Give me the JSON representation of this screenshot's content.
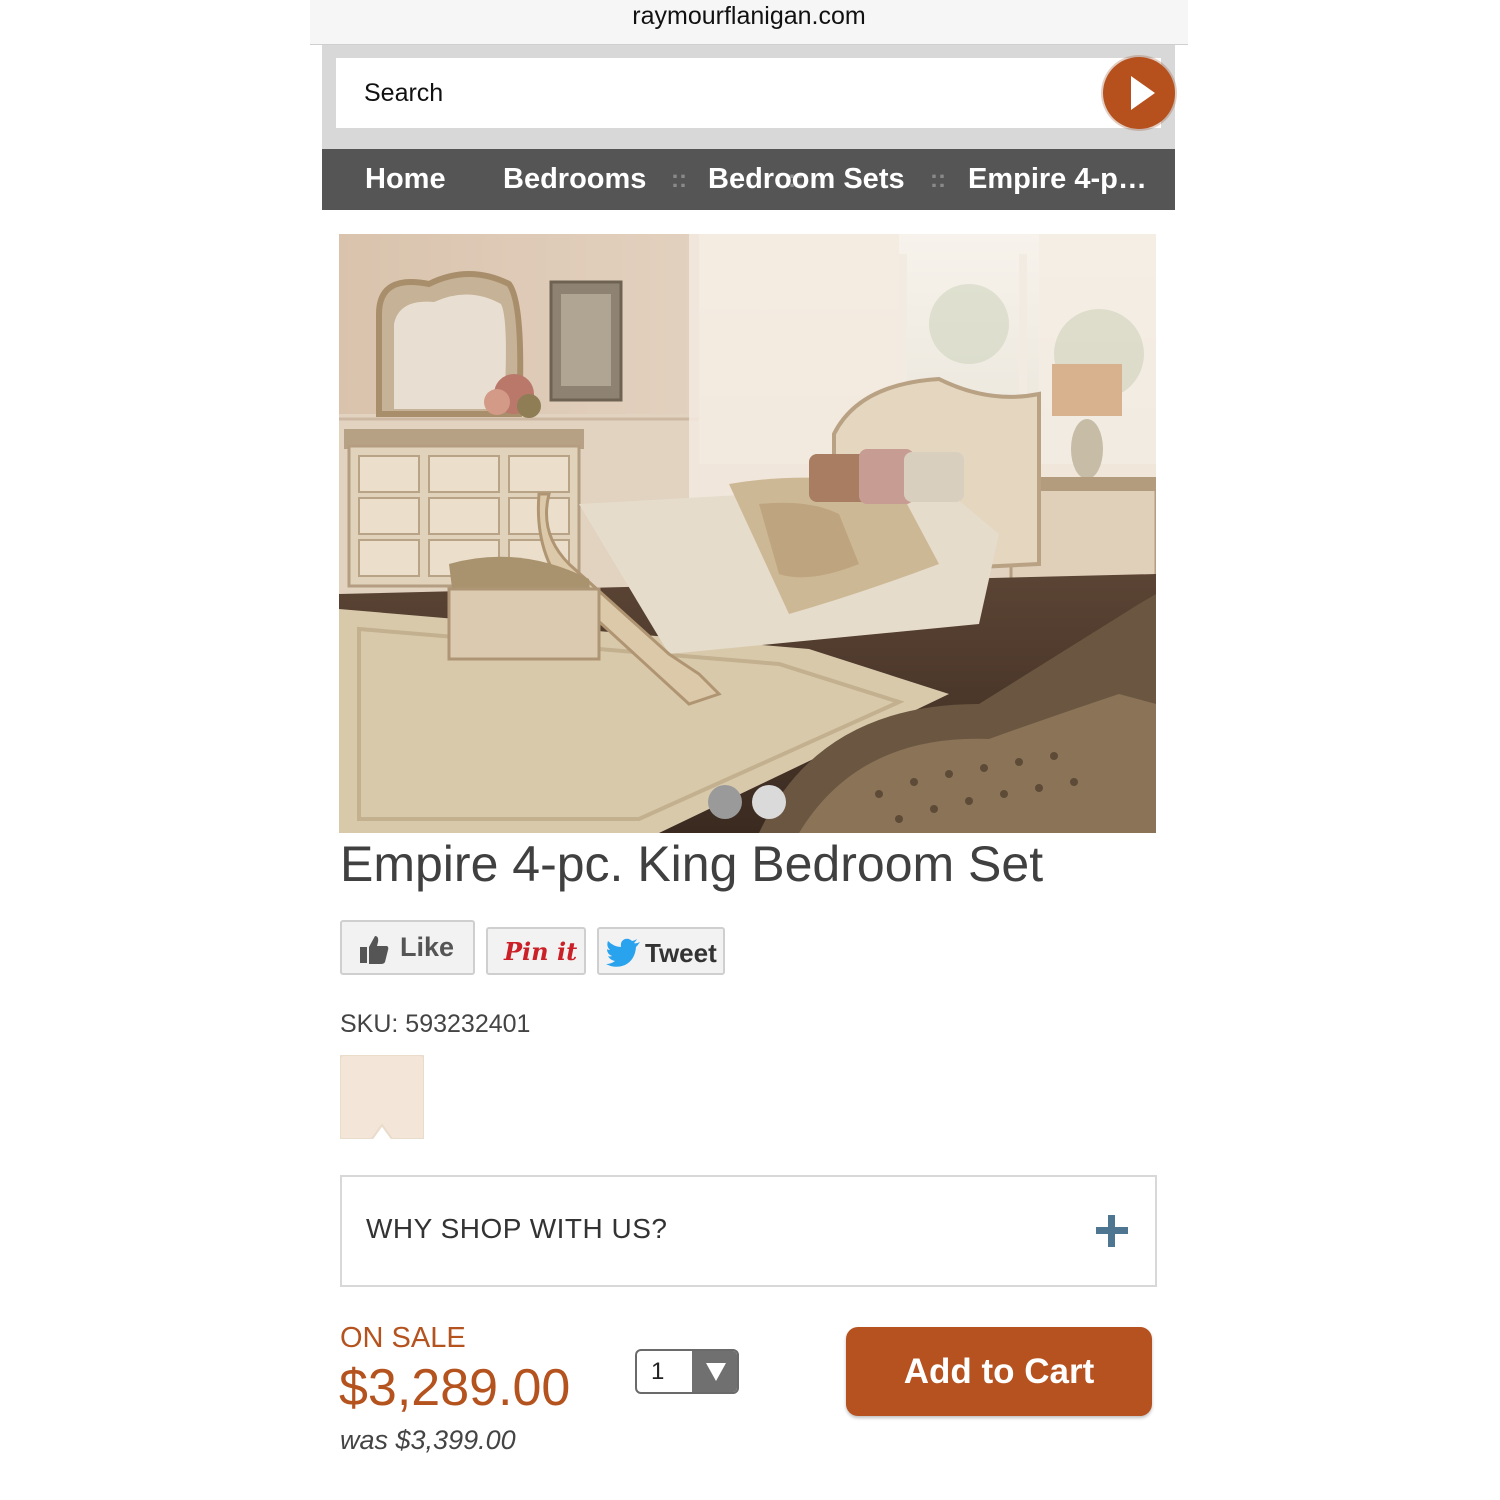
{
  "browser": {
    "url": "raymourflanigan.com"
  },
  "search": {
    "placeholder": "Search"
  },
  "breadcrumb": {
    "items": [
      "Home",
      "Bedrooms",
      "Bedroom Sets",
      "Empire 4-p…"
    ],
    "separator": "::"
  },
  "gallery": {
    "slide_count": 2,
    "active_index": 0
  },
  "product": {
    "title": "Empire 4-pc. King Bedroom Set",
    "sku": "SKU: 593232401",
    "swatch_color": "#f3e6d8"
  },
  "social": {
    "like_label": "Like",
    "pin_label": "Pin it",
    "tweet_label": "Tweet"
  },
  "accordion": {
    "label": "WHY SHOP WITH US?"
  },
  "pricing": {
    "badge": "ON SALE",
    "price": "$3,289.00",
    "was": "was $3,399.00"
  },
  "quantity": {
    "value": "1"
  },
  "cart": {
    "label": "Add to Cart"
  },
  "colors": {
    "brand": "#b5521f",
    "nav_bg": "#555555",
    "accordion_plus": "#4f7690"
  }
}
